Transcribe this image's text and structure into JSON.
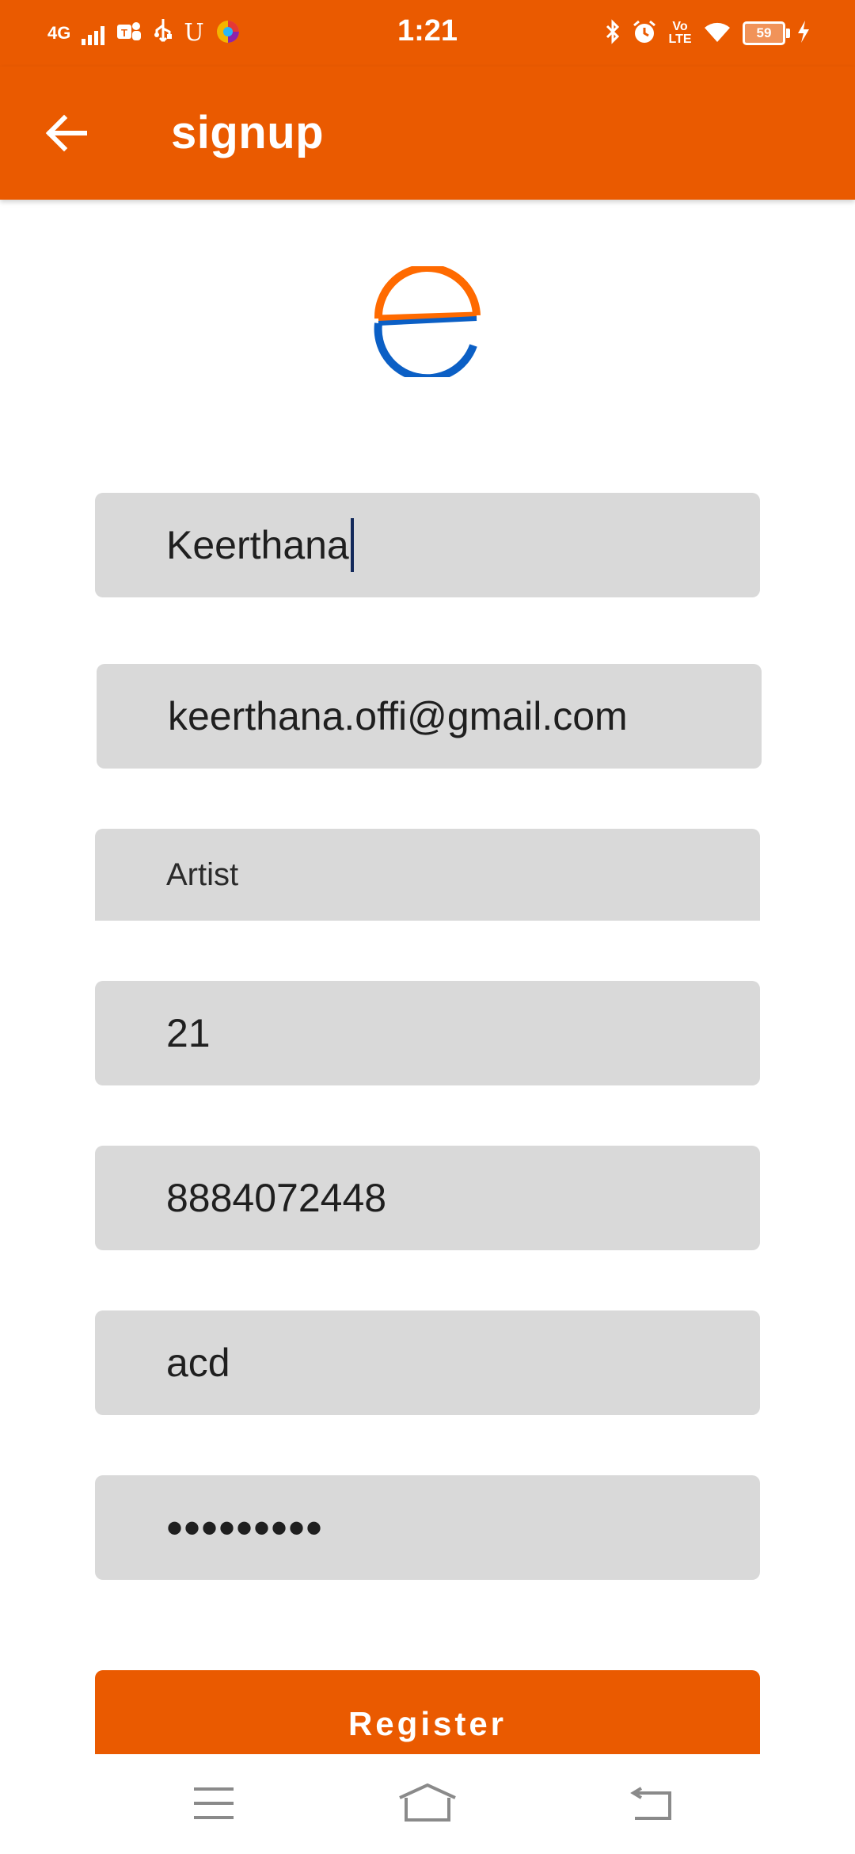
{
  "status_bar": {
    "network": "4G",
    "carrier_glyph": "U",
    "time": "1:21",
    "volte": "Vo LTE",
    "battery": "59",
    "icons": [
      "signal-icon",
      "teams-icon",
      "usb-icon",
      "u-app-icon",
      "app-icon",
      "bluetooth-icon",
      "alarm-icon",
      "volte-icon",
      "wifi-icon",
      "battery-icon",
      "charging-icon"
    ]
  },
  "app_bar": {
    "title": "signup",
    "back_icon": "arrow-back-icon"
  },
  "colors": {
    "primary": "#ea5a00",
    "field_bg": "#d9d9d9",
    "logo_orange": "#ff6a00",
    "logo_blue": "#0b5fc5"
  },
  "form": {
    "name": "Keerthana",
    "email": "keerthana.offi@gmail.com",
    "role": "Artist",
    "age": "21",
    "phone": "8884072448",
    "address": "acd",
    "password": "•••••••••"
  },
  "register_button": {
    "label": "Register"
  },
  "nav_bar": {
    "icons": [
      "menu-icon",
      "home-icon",
      "back-icon"
    ]
  }
}
